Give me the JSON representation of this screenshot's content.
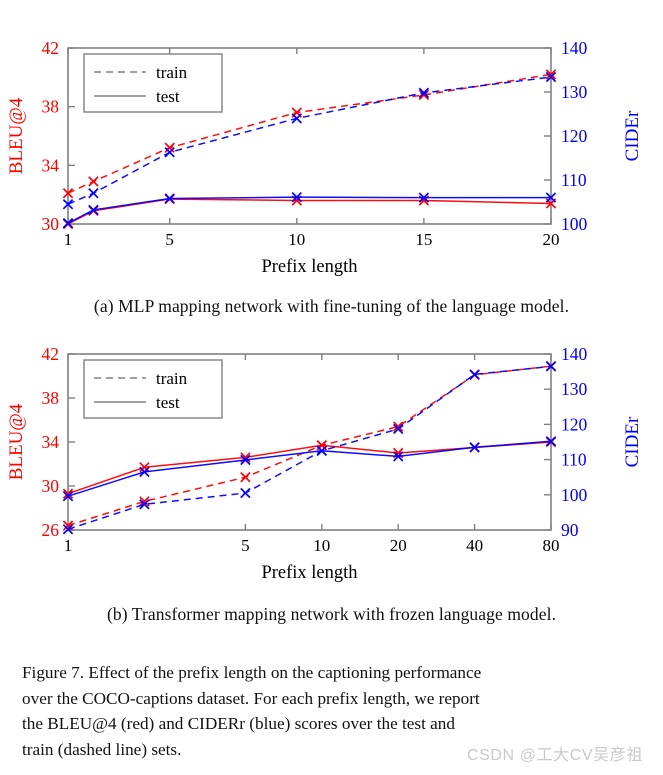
{
  "figure": {
    "caption_line1": "Figure 7. Effect of the prefix length on the captioning performance",
    "caption_line2": "over the COCO-captions dataset. For each prefix length, we report",
    "caption_line3": "the BLEU@4 (red) and CIDERr (blue) scores over the test and",
    "caption_line4": "train (dashed line) sets.",
    "watermark": "CSDN @工大CV吴彦祖"
  },
  "subcaptions": {
    "a": "(a) MLP mapping network with fine-tuning of the language model.",
    "b": "(b) Transformer mapping network with frozen language model."
  },
  "colors": {
    "bleu_red": "#ff0000",
    "cider_blue": "#0000ff",
    "axis_gray": "#808080",
    "legend_line": "#808080",
    "watermark_gray": "#c9c9c9"
  },
  "chart_data": [
    {
      "id": "chart-a",
      "type": "line",
      "title": "(a) MLP mapping network with fine-tuning of the language model.",
      "xlabel": "Prefix length",
      "ylabel_left": "BLEU@4",
      "ylabel_right": "CIDEr",
      "x": [
        1,
        2,
        5,
        10,
        15,
        20
      ],
      "xticks": [
        1,
        5,
        10,
        15,
        20
      ],
      "xticklabels": [
        "1",
        "5",
        "10",
        "15",
        "20"
      ],
      "xscale": "linear",
      "xlim": [
        1,
        20
      ],
      "ylim_left": [
        30,
        42
      ],
      "yticks_left": [
        30,
        34,
        38,
        42
      ],
      "yticklabels_left": [
        "30",
        "34",
        "38",
        "42"
      ],
      "ylim_right": [
        100,
        140
      ],
      "yticks_right": [
        100,
        110,
        120,
        130,
        140
      ],
      "yticklabels_right": [
        "100",
        "110",
        "120",
        "130",
        "140"
      ],
      "grid": false,
      "legend": [
        "train",
        "test"
      ],
      "legend_position": "top-left",
      "series": [
        {
          "name": "BLEU@4 train",
          "color": "#ff0000",
          "axis": "left",
          "style": "dashed",
          "marker": "x",
          "values": [
            32.1,
            32.9,
            35.2,
            37.6,
            38.8,
            40.2
          ]
        },
        {
          "name": "BLEU@4 test",
          "color": "#ff0000",
          "axis": "left",
          "style": "solid",
          "marker": "x",
          "values": [
            30.0,
            30.9,
            31.7,
            31.6,
            31.6,
            31.4
          ]
        },
        {
          "name": "CIDEr train",
          "color": "#0000ff",
          "axis": "right",
          "style": "dashed",
          "marker": "x",
          "values": [
            104.5,
            107.0,
            116.3,
            124.0,
            129.8,
            133.4
          ]
        },
        {
          "name": "CIDEr test",
          "color": "#0000ff",
          "axis": "right",
          "style": "solid",
          "marker": "x",
          "values": [
            100.2,
            103.2,
            105.8,
            106.1,
            106.0,
            106.0
          ]
        }
      ]
    },
    {
      "id": "chart-b",
      "type": "line",
      "title": "(b) Transformer mapping network with frozen language model.",
      "xlabel": "Prefix length",
      "ylabel_left": "BLEU@4",
      "ylabel_right": "CIDEr",
      "x": [
        1,
        2,
        5,
        10,
        20,
        40,
        80
      ],
      "xticks": [
        1,
        5,
        10,
        20,
        40,
        80
      ],
      "xticklabels": [
        "1",
        "5",
        "10",
        "20",
        "40",
        "80"
      ],
      "xscale": "log",
      "xlim": [
        1,
        80
      ],
      "ylim_left": [
        26,
        42
      ],
      "yticks_left": [
        26,
        30,
        34,
        38,
        42
      ],
      "yticklabels_left": [
        "26",
        "30",
        "34",
        "38",
        "42"
      ],
      "ylim_right": [
        90,
        140
      ],
      "yticks_right": [
        90,
        100,
        110,
        120,
        130,
        140
      ],
      "yticklabels_right": [
        "90",
        "100",
        "110",
        "120",
        "130",
        "140"
      ],
      "grid": false,
      "legend": [
        "train",
        "test"
      ],
      "legend_position": "top-left",
      "series": [
        {
          "name": "BLEU@4 train",
          "color": "#ff0000",
          "axis": "left",
          "style": "dashed",
          "marker": "x",
          "values": [
            26.4,
            28.6,
            30.8,
            33.7,
            35.4,
            40.1,
            40.9
          ]
        },
        {
          "name": "BLEU@4 test",
          "color": "#ff0000",
          "axis": "left",
          "style": "solid",
          "marker": "x",
          "values": [
            29.3,
            31.7,
            32.6,
            33.7,
            33.0,
            33.5,
            34.0
          ]
        },
        {
          "name": "CIDEr train",
          "color": "#0000ff",
          "axis": "right",
          "style": "dashed",
          "marker": "x",
          "values": [
            90.2,
            97.3,
            100.5,
            112.5,
            118.7,
            134.2,
            136.5
          ]
        },
        {
          "name": "CIDEr test",
          "color": "#0000ff",
          "axis": "right",
          "style": "solid",
          "marker": "x",
          "values": [
            99.6,
            106.5,
            109.9,
            112.5,
            110.9,
            113.5,
            115.2
          ]
        }
      ]
    }
  ]
}
